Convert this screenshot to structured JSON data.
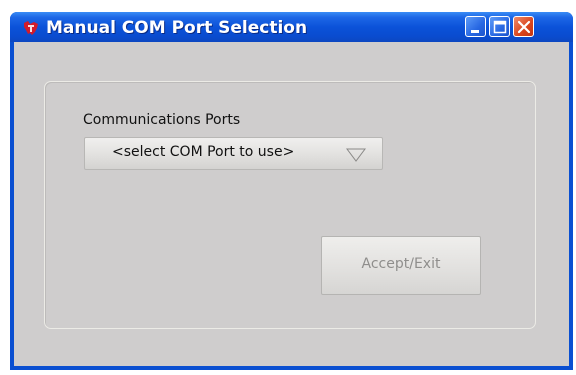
{
  "window": {
    "title": "Manual COM Port Selection",
    "icon": "ti-logo-icon",
    "controls": {
      "minimize": "minimize-icon",
      "maximize": "maximize-icon",
      "close": "close-icon"
    }
  },
  "ports": {
    "label": "Communications Ports",
    "selected": "<select COM Port to use>",
    "dropdown_icon": "triangle-down-icon"
  },
  "actions": {
    "accept_label": "Accept/Exit",
    "accept_enabled": false
  },
  "colors": {
    "titlebar": "#0b52d9",
    "client_bg": "#cfcdcd",
    "close_button": "#d9441c",
    "disabled_text": "#8f8e8c"
  }
}
